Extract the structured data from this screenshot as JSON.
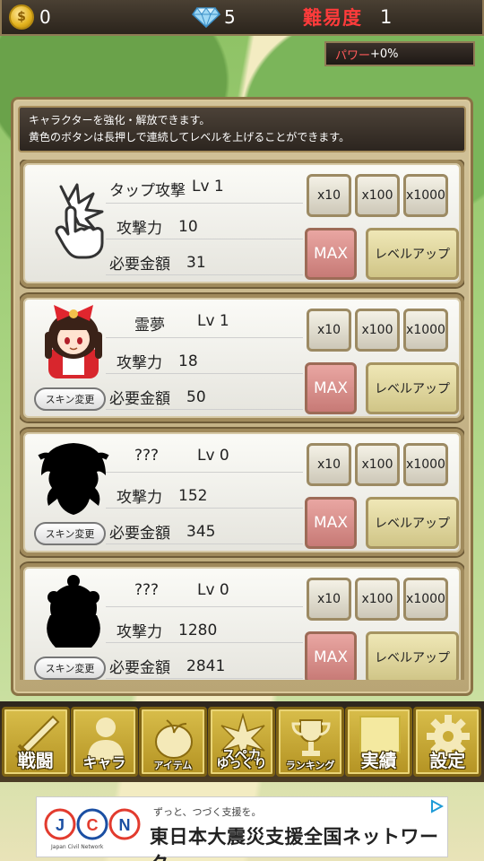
{
  "topbar": {
    "coin_symbol": "$",
    "coins": "0",
    "gems": "5",
    "difficulty_label": "難易度",
    "difficulty_value": "1"
  },
  "power": {
    "label": "パワー",
    "value": "+0%"
  },
  "info": {
    "line1": "キャラクターを強化・解放できます。",
    "line2": "黄色のボタンは長押しで連続してレベルを上げることができます。"
  },
  "labels": {
    "attack": "攻撃力",
    "cost": "必要金額",
    "skin": "スキン変更",
    "x10": "x10",
    "x100": "x100",
    "x1000": "x1000",
    "max": "MAX",
    "levelup": "レベルアップ"
  },
  "units": [
    {
      "name": "タップ攻撃",
      "level": "Lv 1",
      "attack": "10",
      "cost": "31"
    },
    {
      "name": "霊夢",
      "level": "Lv 1",
      "attack": "18",
      "cost": "50"
    },
    {
      "name": "???",
      "level": "Lv 0",
      "attack": "152",
      "cost": "345"
    },
    {
      "name": "???",
      "level": "Lv 0",
      "attack": "1280",
      "cost": "2841"
    }
  ],
  "nav": [
    {
      "label": "戦闘",
      "icon": "sword-icon"
    },
    {
      "label": "キャラ",
      "icon": "character-icon"
    },
    {
      "label": "アイテム",
      "icon": "item-icon"
    },
    {
      "top": "スペカ",
      "label": "ゆっくり",
      "icon": "spellcard-icon"
    },
    {
      "label": "ランキング",
      "icon": "trophy-icon"
    },
    {
      "label": "実績",
      "icon": "achievement-icon"
    },
    {
      "label": "設定",
      "icon": "gear-icon"
    }
  ],
  "ad": {
    "logo_text": "JCN",
    "logo_sub": "Japan Civil Network",
    "tagline": "ずっと、つづく支援を。",
    "headline": "東日本大震災支援全国ネットワーク"
  },
  "colors": {
    "difficulty": "#ff3b3b",
    "max_button": "#d9908b",
    "levelup_button": "#e3d99f",
    "nav_gold": "#c9ab36"
  }
}
